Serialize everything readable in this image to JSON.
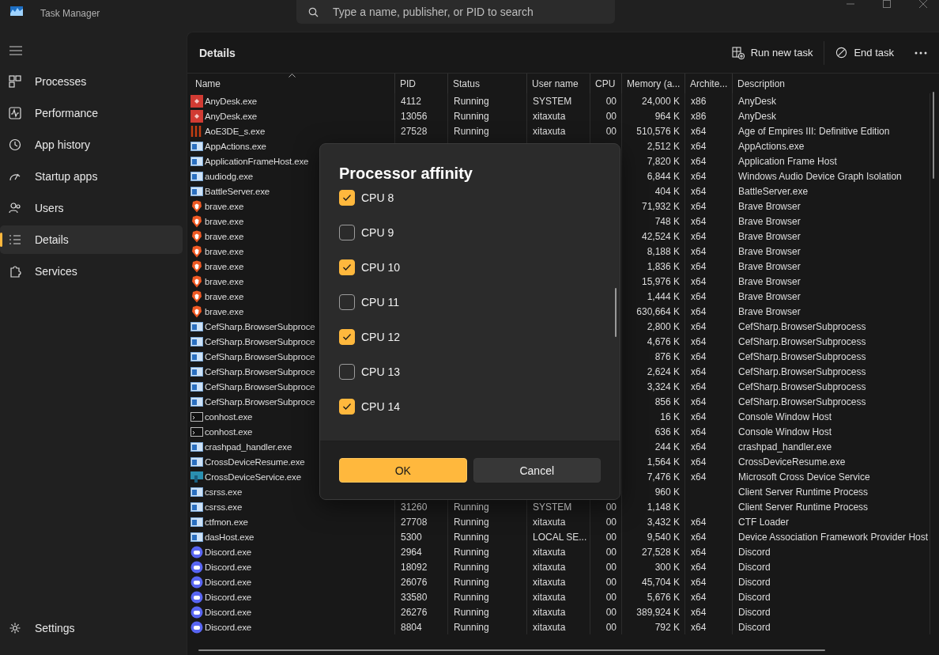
{
  "window": {
    "title": "Task Manager"
  },
  "search": {
    "placeholder": "Type a name, publisher, or PID to search"
  },
  "sidebar": {
    "items": [
      {
        "label": "Processes",
        "kind": "processes",
        "selected": false
      },
      {
        "label": "Performance",
        "kind": "performance",
        "selected": false
      },
      {
        "label": "App history",
        "kind": "history",
        "selected": false
      },
      {
        "label": "Startup apps",
        "kind": "startup",
        "selected": false
      },
      {
        "label": "Users",
        "kind": "users",
        "selected": false
      },
      {
        "label": "Details",
        "kind": "details",
        "selected": true
      },
      {
        "label": "Services",
        "kind": "services",
        "selected": false
      }
    ],
    "settings": "Settings"
  },
  "page": {
    "title": "Details",
    "actions": [
      {
        "label": "Run new task",
        "kind": "run"
      },
      {
        "label": "End task",
        "kind": "end"
      }
    ]
  },
  "table": {
    "columns": [
      "Name",
      "PID",
      "Status",
      "User name",
      "CPU",
      "Memory (a...",
      "Archite...",
      "Description"
    ],
    "rows": [
      {
        "kind": "anydesk",
        "name": "AnyDesk.exe",
        "pid": "4112",
        "status": "Running",
        "user": "SYSTEM",
        "cpu": "00",
        "memory": "24,000 K",
        "arch": "x86",
        "description": "AnyDesk"
      },
      {
        "kind": "anydesk",
        "name": "AnyDesk.exe",
        "pid": "13056",
        "status": "Running",
        "user": "xitaxuta",
        "cpu": "00",
        "memory": "964 K",
        "arch": "x86",
        "description": "AnyDesk"
      },
      {
        "kind": "bars",
        "name": "AoE3DE_s.exe",
        "pid": "27528",
        "status": "Running",
        "user": "xitaxuta",
        "cpu": "00",
        "memory": "510,576 K",
        "arch": "x64",
        "description": "Age of Empires III: Definitive Edition"
      },
      {
        "kind": "window",
        "name": "AppActions.exe",
        "memory": "2,512 K",
        "arch": "x64",
        "description": "AppActions.exe"
      },
      {
        "kind": "window",
        "name": "ApplicationFrameHost.exe",
        "memory": "7,820 K",
        "arch": "x64",
        "description": "Application Frame Host"
      },
      {
        "kind": "window",
        "name": "audiodg.exe",
        "memory": "6,844 K",
        "arch": "x64",
        "description": "Windows Audio Device Graph Isolation"
      },
      {
        "kind": "window",
        "name": "BattleServer.exe",
        "memory": "404 K",
        "arch": "x64",
        "description": "BattleServer.exe"
      },
      {
        "kind": "lion",
        "name": "brave.exe",
        "memory": "71,932 K",
        "arch": "x64",
        "description": "Brave Browser"
      },
      {
        "kind": "lion",
        "name": "brave.exe",
        "memory": "748 K",
        "arch": "x64",
        "description": "Brave Browser"
      },
      {
        "kind": "lion",
        "name": "brave.exe",
        "memory": "42,524 K",
        "arch": "x64",
        "description": "Brave Browser"
      },
      {
        "kind": "lion",
        "name": "brave.exe",
        "memory": "8,188 K",
        "arch": "x64",
        "description": "Brave Browser"
      },
      {
        "kind": "lion",
        "name": "brave.exe",
        "memory": "1,836 K",
        "arch": "x64",
        "description": "Brave Browser"
      },
      {
        "kind": "lion",
        "name": "brave.exe",
        "memory": "15,976 K",
        "arch": "x64",
        "description": "Brave Browser"
      },
      {
        "kind": "lion",
        "name": "brave.exe",
        "memory": "1,444 K",
        "arch": "x64",
        "description": "Brave Browser"
      },
      {
        "kind": "lion",
        "name": "brave.exe",
        "memory": "630,664 K",
        "arch": "x64",
        "description": "Brave Browser"
      },
      {
        "kind": "window",
        "name": "CefSharp.BrowserSubproce",
        "memory": "2,800 K",
        "arch": "x64",
        "description": "CefSharp.BrowserSubprocess"
      },
      {
        "kind": "window",
        "name": "CefSharp.BrowserSubproce",
        "memory": "4,676 K",
        "arch": "x64",
        "description": "CefSharp.BrowserSubprocess"
      },
      {
        "kind": "window",
        "name": "CefSharp.BrowserSubproce",
        "memory": "876 K",
        "arch": "x64",
        "description": "CefSharp.BrowserSubprocess"
      },
      {
        "kind": "window",
        "name": "CefSharp.BrowserSubproce",
        "memory": "2,624 K",
        "arch": "x64",
        "description": "CefSharp.BrowserSubprocess"
      },
      {
        "kind": "window",
        "name": "CefSharp.BrowserSubproce",
        "memory": "3,324 K",
        "arch": "x64",
        "description": "CefSharp.BrowserSubprocess"
      },
      {
        "kind": "window",
        "name": "CefSharp.BrowserSubproce",
        "memory": "856 K",
        "arch": "x64",
        "description": "CefSharp.BrowserSubprocess"
      },
      {
        "kind": "console",
        "name": "conhost.exe",
        "memory": "16 K",
        "arch": "x64",
        "description": "Console Window Host"
      },
      {
        "kind": "console",
        "name": "conhost.exe",
        "memory": "636 K",
        "arch": "x64",
        "description": "Console Window Host"
      },
      {
        "kind": "window",
        "name": "crashpad_handler.exe",
        "memory": "244 K",
        "arch": "x64",
        "description": "crashpad_handler.exe"
      },
      {
        "kind": "window",
        "name": "CrossDeviceResume.exe",
        "memory": "1,564 K",
        "arch": "x64",
        "description": "CrossDeviceResume.exe"
      },
      {
        "kind": "monitor",
        "name": "CrossDeviceService.exe",
        "memory": "7,476 K",
        "arch": "x64",
        "description": "Microsoft Cross Device Service"
      },
      {
        "kind": "window",
        "name": "csrss.exe",
        "memory": "960 K",
        "description": "Client Server Runtime Process"
      },
      {
        "kind": "window",
        "name": "csrss.exe",
        "pid": "31260",
        "status": "Running",
        "user": "SYSTEM",
        "cpu": "00",
        "memory": "1,148 K",
        "description": "Client Server Runtime Process"
      },
      {
        "kind": "window",
        "name": "ctfmon.exe",
        "pid": "27708",
        "status": "Running",
        "user": "xitaxuta",
        "cpu": "00",
        "memory": "3,432 K",
        "arch": "x64",
        "description": "CTF Loader"
      },
      {
        "kind": "window",
        "name": "dasHost.exe",
        "pid": "5300",
        "status": "Running",
        "user": "LOCAL SE...",
        "cpu": "00",
        "memory": "9,540 K",
        "arch": "x64",
        "description": "Device Association Framework Provider Host"
      },
      {
        "kind": "chat",
        "name": "Discord.exe",
        "pid": "2964",
        "status": "Running",
        "user": "xitaxuta",
        "cpu": "00",
        "memory": "27,528 K",
        "arch": "x64",
        "description": "Discord"
      },
      {
        "kind": "chat",
        "name": "Discord.exe",
        "pid": "18092",
        "status": "Running",
        "user": "xitaxuta",
        "cpu": "00",
        "memory": "300 K",
        "arch": "x64",
        "description": "Discord"
      },
      {
        "kind": "chat",
        "name": "Discord.exe",
        "pid": "26076",
        "status": "Running",
        "user": "xitaxuta",
        "cpu": "00",
        "memory": "45,704 K",
        "arch": "x64",
        "description": "Discord"
      },
      {
        "kind": "chat",
        "name": "Discord.exe",
        "pid": "33580",
        "status": "Running",
        "user": "xitaxuta",
        "cpu": "00",
        "memory": "5,676 K",
        "arch": "x64",
        "description": "Discord"
      },
      {
        "kind": "chat",
        "name": "Discord.exe",
        "pid": "26276",
        "status": "Running",
        "user": "xitaxuta",
        "cpu": "00",
        "memory": "389,924 K",
        "arch": "x64",
        "description": "Discord"
      },
      {
        "kind": "chat",
        "name": "Discord.exe",
        "pid": "8804",
        "status": "Running",
        "user": "xitaxuta",
        "cpu": "00",
        "memory": "792 K",
        "arch": "x64",
        "description": "Discord"
      }
    ]
  },
  "dialog": {
    "title": "Processor affinity",
    "options": [
      {
        "label": "CPU 8",
        "checked": true
      },
      {
        "label": "CPU 9",
        "checked": false
      },
      {
        "label": "CPU 10",
        "checked": true
      },
      {
        "label": "CPU 11",
        "checked": false
      },
      {
        "label": "CPU 12",
        "checked": true
      },
      {
        "label": "CPU 13",
        "checked": false
      },
      {
        "label": "CPU 14",
        "checked": true
      }
    ],
    "buttons": [
      {
        "label": "OK",
        "kind": "primary"
      },
      {
        "label": "Cancel",
        "kind": "secondary"
      }
    ]
  }
}
